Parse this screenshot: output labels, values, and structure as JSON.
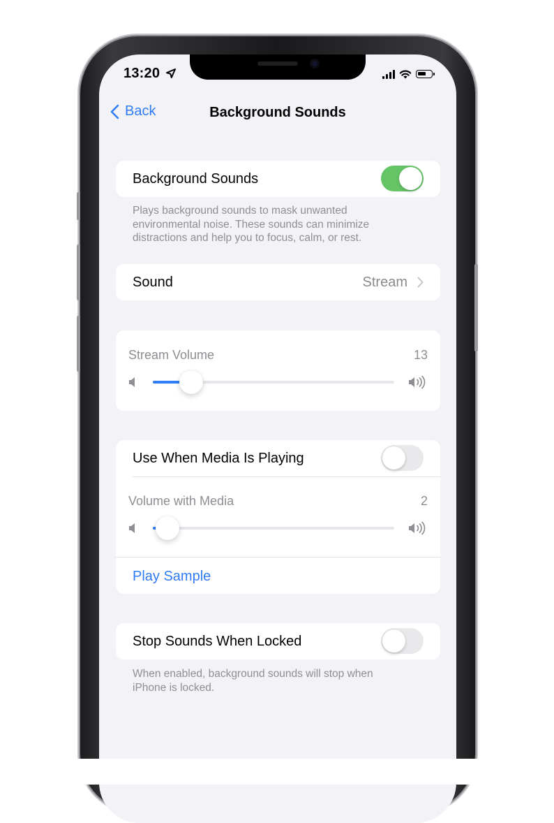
{
  "status_bar": {
    "time": "13:20",
    "icons": [
      "location-arrow-icon",
      "signal-icon",
      "wifi-icon",
      "battery-icon"
    ]
  },
  "nav": {
    "back_label": "Back",
    "title": "Background Sounds"
  },
  "background_sounds": {
    "label": "Background Sounds",
    "enabled": true,
    "footnote": "Plays background sounds to mask unwanted environmental noise. These sounds can minimize distractions and help you to focus, calm, or rest."
  },
  "sound": {
    "label": "Sound",
    "value": "Stream"
  },
  "stream_volume": {
    "label": "Stream Volume",
    "value": "13",
    "level": 0.16
  },
  "media": {
    "label": "Use When Media Is Playing",
    "enabled": false,
    "volume_label": "Volume with Media",
    "volume_value": "2",
    "volume_level": 0.06,
    "play_sample_label": "Play Sample"
  },
  "stop_when_locked": {
    "label": "Stop Sounds When Locked",
    "enabled": false,
    "footnote": "When enabled, background sounds will stop when iPhone is locked."
  },
  "colors": {
    "accent": "#2f7cf6",
    "toggle_on": "#65c466",
    "background": "#f2f2f7",
    "secondary_text": "#8e8e93"
  }
}
